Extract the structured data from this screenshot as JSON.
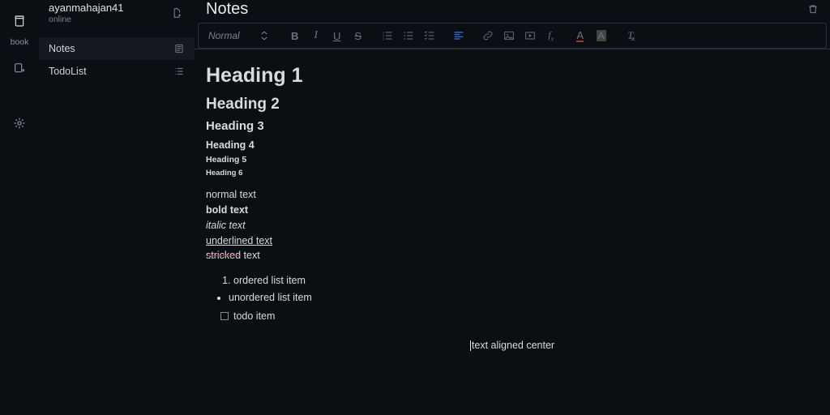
{
  "rail": {
    "book_label": "book"
  },
  "sidebar": {
    "user": {
      "name": "ayanmahajan41",
      "status": "online"
    },
    "items": [
      {
        "label": "Notes",
        "icon": "note-icon",
        "active": true
      },
      {
        "label": "TodoList",
        "icon": "list-icon",
        "active": false
      }
    ]
  },
  "page": {
    "title": "Notes"
  },
  "toolbar": {
    "format_select": "Normal"
  },
  "content": {
    "h1": "Heading 1",
    "h2": "Heading 2",
    "h3": "Heading 3",
    "h4": "Heading 4",
    "h5": "Heading 5",
    "h6": "Heading 6",
    "normal": "normal text",
    "bold": "bold text",
    "italic": "italic text",
    "underlined": "underlined text",
    "stricked_word": "stricked",
    "stricked_rest": " text",
    "ordered": "ordered list item",
    "unordered": "unordered list item",
    "todo": "todo item",
    "center": "text aligned center"
  }
}
